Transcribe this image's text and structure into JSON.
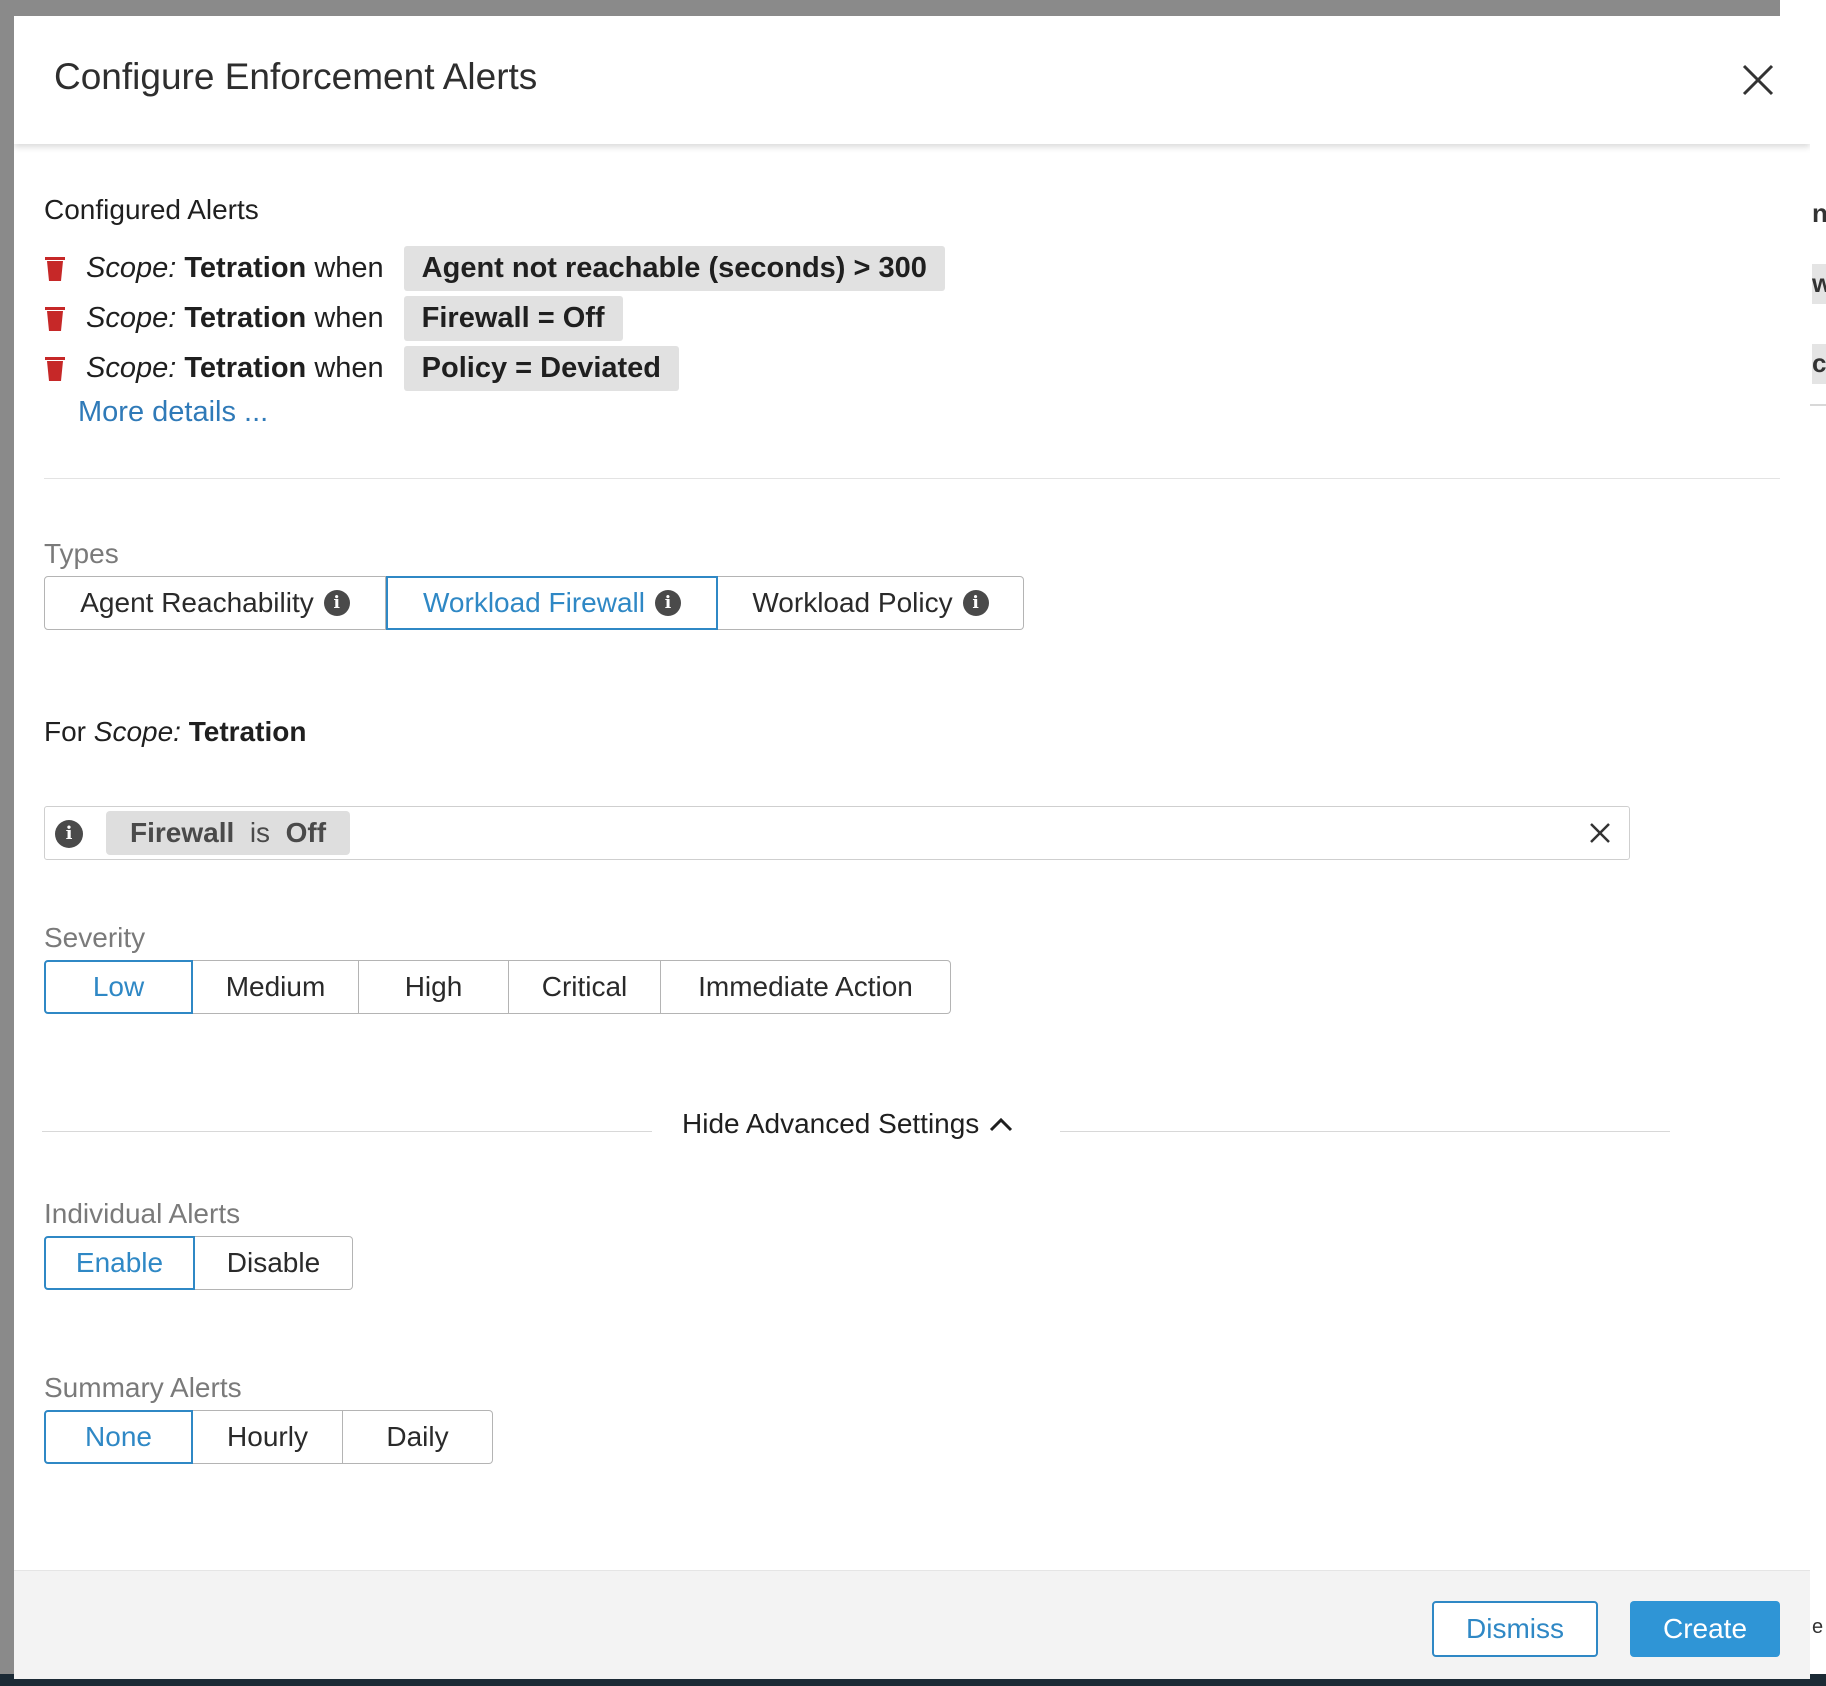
{
  "background": {
    "edge_chars": [
      "n",
      "w",
      "c"
    ],
    "edge_text": "e"
  },
  "dialog": {
    "title": "Configure Enforcement Alerts",
    "close_icon": "close-icon"
  },
  "configured_alerts": {
    "title": "Configured Alerts",
    "items": [
      {
        "scope_label": "Scope:",
        "scope_value": "Tetration",
        "when": "when",
        "condition": "Agent not reachable (seconds) > 300"
      },
      {
        "scope_label": "Scope:",
        "scope_value": "Tetration",
        "when": "when",
        "condition": "Firewall = Off"
      },
      {
        "scope_label": "Scope:",
        "scope_value": "Tetration",
        "when": "when",
        "condition": "Policy = Deviated"
      }
    ],
    "more_link": "More details ..."
  },
  "types": {
    "label": "Types",
    "options": [
      "Agent Reachability",
      "Workload Firewall",
      "Workload Policy"
    ],
    "selected": "Workload Firewall"
  },
  "for_scope": {
    "prefix": "For",
    "scope_label": "Scope:",
    "scope_value": "Tetration"
  },
  "filter": {
    "field": "Firewall",
    "operator": "is",
    "value": "Off"
  },
  "severity": {
    "label": "Severity",
    "options": [
      "Low",
      "Medium",
      "High",
      "Critical",
      "Immediate Action"
    ],
    "selected": "Low"
  },
  "advanced": {
    "toggle_label": "Hide Advanced Settings"
  },
  "individual_alerts": {
    "label": "Individual Alerts",
    "options": [
      "Enable",
      "Disable"
    ],
    "selected": "Enable"
  },
  "summary_alerts": {
    "label": "Summary Alerts",
    "options": [
      "None",
      "Hourly",
      "Daily"
    ],
    "selected": "None"
  },
  "footer": {
    "dismiss": "Dismiss",
    "create": "Create"
  },
  "colors": {
    "accent": "#2f88c5",
    "primary_button": "#2f95d6",
    "trash": "#c62828",
    "chip": "#e1e1e1"
  }
}
